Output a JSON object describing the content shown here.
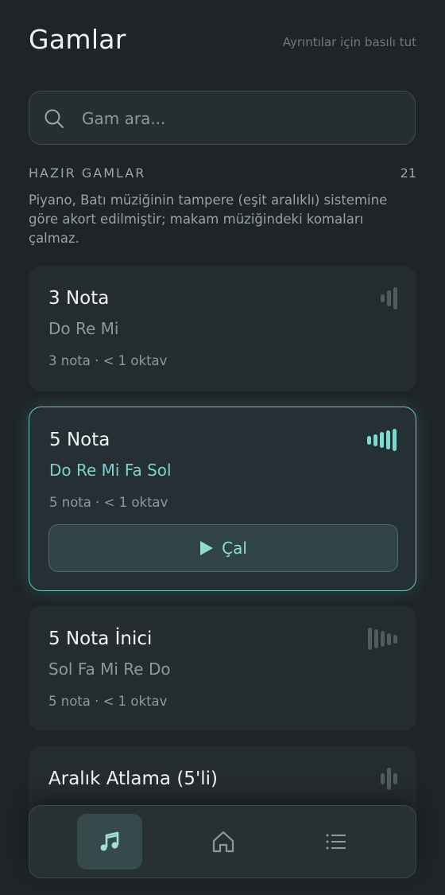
{
  "header": {
    "title": "Gamlar",
    "hint": "Ayrıntılar için basılı tut"
  },
  "search": {
    "placeholder": "Gam ara..."
  },
  "section": {
    "label": "HAZIR GAMLAR",
    "count": "21",
    "note": "Piyano, Batı müziğinin tampere (eşit aralıklı) sistemine göre akort edilmiştir; makam müziğindeki komaları çalmaz."
  },
  "scales": [
    {
      "title": "3 Nota",
      "notes": "Do Re Mi",
      "meta": "3 nota · < 1 oktav",
      "bar_levels": [
        0.35,
        0.7,
        1.0
      ]
    },
    {
      "title": "5 Nota",
      "notes": "Do Re Mi Fa Sol",
      "meta": "5 nota · < 1 oktav",
      "active": true,
      "play_label": "Çal",
      "bar_levels": [
        0.4,
        0.55,
        0.7,
        0.85,
        1.0
      ]
    },
    {
      "title": "5 Nota İnici",
      "notes": "Sol Fa Mi Re Do",
      "meta": "5 nota · < 1 oktav",
      "bar_levels": [
        1.0,
        0.85,
        0.7,
        0.55,
        0.4
      ]
    },
    {
      "title": "Aralık Atlama (5'li)",
      "notes": "",
      "meta": "",
      "bar_levels": [
        0.5,
        1.0,
        0.5
      ]
    }
  ],
  "tabbar": {
    "tabs": [
      "music-note-icon",
      "home-icon",
      "list-icon"
    ],
    "active_index": 0
  },
  "colors": {
    "background": "#1e2427",
    "accent": "#6cc2bd",
    "card": "#252c30"
  }
}
